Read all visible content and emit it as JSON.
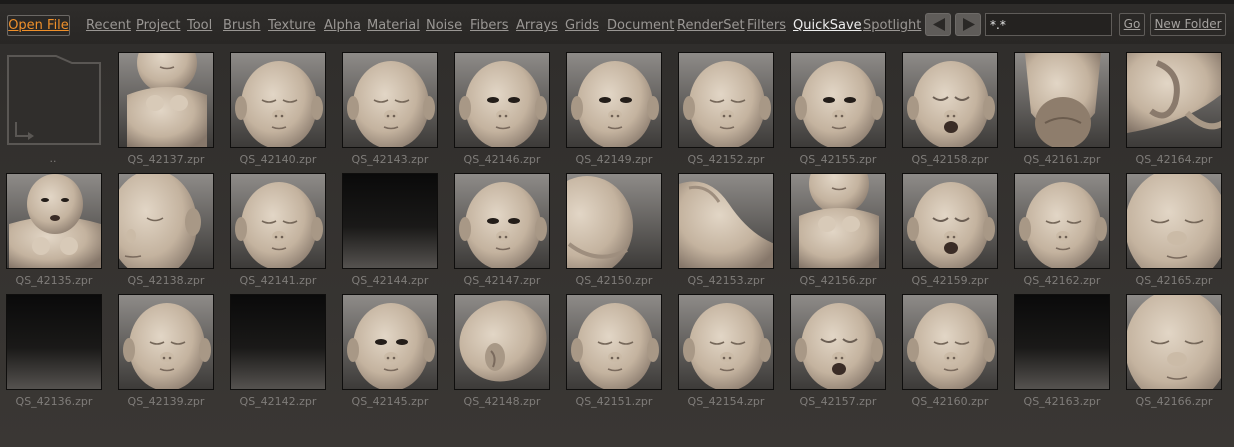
{
  "toolbar": {
    "open_file": "Open File",
    "nav": [
      {
        "label": "Recent",
        "active": false
      },
      {
        "label": "Project",
        "active": false
      },
      {
        "label": "Tool",
        "active": false
      },
      {
        "label": "Brush",
        "active": false
      },
      {
        "label": "Texture",
        "active": false
      },
      {
        "label": "Alpha",
        "active": false
      },
      {
        "label": "Material",
        "active": false
      },
      {
        "label": "Noise",
        "active": false
      },
      {
        "label": "Fibers",
        "active": false
      },
      {
        "label": "Arrays",
        "active": false
      },
      {
        "label": "Grids",
        "active": false
      },
      {
        "label": "Document",
        "active": false
      },
      {
        "label": "RenderSet",
        "active": false
      },
      {
        "label": "Filters",
        "active": false
      },
      {
        "label": "QuickSave",
        "active": true
      },
      {
        "label": "Spotlight",
        "active": false
      }
    ],
    "filter_value": "*.*",
    "go_label": "Go",
    "new_folder_label": "New Folder"
  },
  "colors": {
    "accent": "#f0902a",
    "active_tab": "#eeeeee",
    "inactive_tab": "#9a9794",
    "label": "#7f7c79"
  },
  "browser": {
    "parent_label": "..",
    "files": [
      {
        "name": "QS_42137.zpr",
        "thumb": "torso"
      },
      {
        "name": "QS_42140.zpr",
        "thumb": "face-sleep"
      },
      {
        "name": "QS_42143.zpr",
        "thumb": "face-sleep"
      },
      {
        "name": "QS_42146.zpr",
        "thumb": "face-open"
      },
      {
        "name": "QS_42149.zpr",
        "thumb": "face-open"
      },
      {
        "name": "QS_42152.zpr",
        "thumb": "face-sleep"
      },
      {
        "name": "QS_42155.zpr",
        "thumb": "face-open"
      },
      {
        "name": "QS_42158.zpr",
        "thumb": "face-cry"
      },
      {
        "name": "QS_42161.zpr",
        "thumb": "head-back"
      },
      {
        "name": "QS_42164.zpr",
        "thumb": "ear-closeup"
      },
      {
        "name": "QS_42135.zpr",
        "thumb": "torso-face"
      },
      {
        "name": "QS_42138.zpr",
        "thumb": "face-side"
      },
      {
        "name": "QS_42141.zpr",
        "thumb": "face-sleep"
      },
      {
        "name": "QS_42144.zpr",
        "thumb": "empty"
      },
      {
        "name": "QS_42147.zpr",
        "thumb": "face-open"
      },
      {
        "name": "QS_42150.zpr",
        "thumb": "head-profile"
      },
      {
        "name": "QS_42153.zpr",
        "thumb": "shoulder"
      },
      {
        "name": "QS_42156.zpr",
        "thumb": "torso"
      },
      {
        "name": "QS_42159.zpr",
        "thumb": "face-cry"
      },
      {
        "name": "QS_42162.zpr",
        "thumb": "face-sleep"
      },
      {
        "name": "QS_42165.zpr",
        "thumb": "face-closeup"
      },
      {
        "name": "QS_42136.zpr",
        "thumb": "empty"
      },
      {
        "name": "QS_42139.zpr",
        "thumb": "face-sleep"
      },
      {
        "name": "QS_42142.zpr",
        "thumb": "empty"
      },
      {
        "name": "QS_42145.zpr",
        "thumb": "face-open"
      },
      {
        "name": "QS_42148.zpr",
        "thumb": "head-side"
      },
      {
        "name": "QS_42151.zpr",
        "thumb": "face-sleep"
      },
      {
        "name": "QS_42154.zpr",
        "thumb": "face-sleep"
      },
      {
        "name": "QS_42157.zpr",
        "thumb": "face-cry"
      },
      {
        "name": "QS_42160.zpr",
        "thumb": "face-sleep"
      },
      {
        "name": "QS_42163.zpr",
        "thumb": "empty"
      },
      {
        "name": "QS_42166.zpr",
        "thumb": "face-closeup"
      }
    ]
  }
}
